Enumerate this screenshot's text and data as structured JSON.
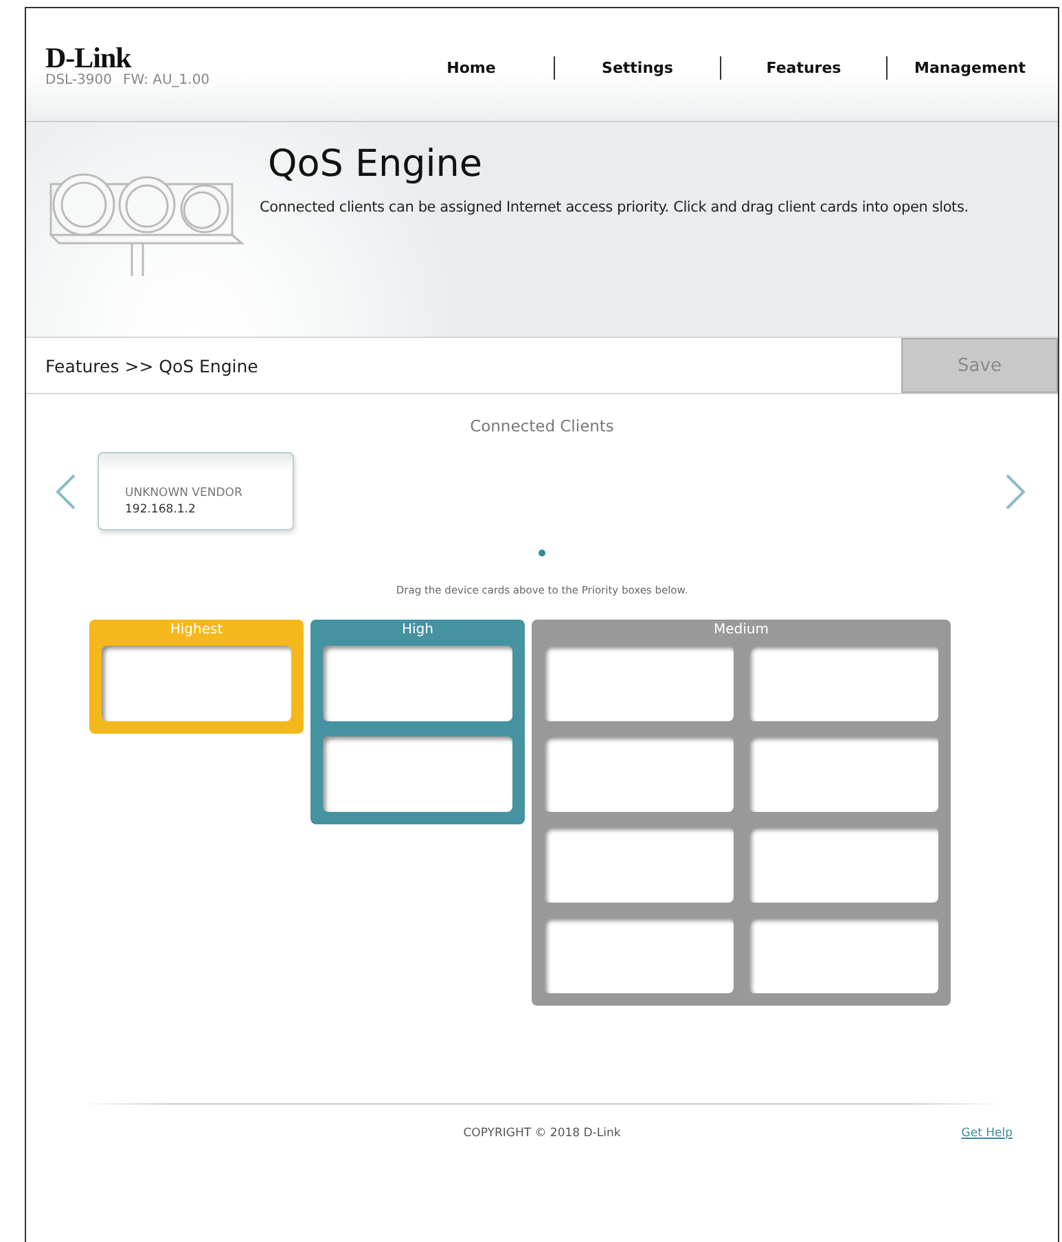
{
  "header": {
    "brand": "D-Link",
    "model": "DSL-3900",
    "firmware": "FW: AU_1.00",
    "nav": [
      {
        "label": "Home"
      },
      {
        "label": "Settings"
      },
      {
        "label": "Features"
      },
      {
        "label": "Management"
      }
    ]
  },
  "banner": {
    "title": "QoS Engine",
    "description": "Connected clients can be assigned Internet access priority. Click and drag client cards into open slots."
  },
  "breadcrumb": "Features >> QoS Engine",
  "save_button": {
    "label": "Save",
    "disabled": true
  },
  "connected_clients": {
    "title": "Connected Clients",
    "clients": [
      {
        "vendor": "UNKNOWN VENDOR",
        "ip": "192.168.1.2"
      }
    ],
    "pages": [
      {
        "selected": true
      }
    ]
  },
  "instruction": "Drag the device cards above to the Priority boxes below.",
  "priority_groups": [
    {
      "name": "Highest",
      "color": "#f5b81c",
      "slots": [
        {
          "empty": true
        }
      ]
    },
    {
      "name": "High",
      "color": "#4592a0",
      "slots": [
        {
          "empty": true
        },
        {
          "empty": true
        }
      ]
    },
    {
      "name": "Medium",
      "color": "#999999",
      "slots": [
        {
          "empty": true
        },
        {
          "empty": true
        },
        {
          "empty": true
        },
        {
          "empty": true
        },
        {
          "empty": true
        },
        {
          "empty": true
        },
        {
          "empty": true
        },
        {
          "empty": true
        }
      ]
    }
  ],
  "footer": {
    "copyright": "COPYRIGHT © 2018 D-Link",
    "help_link": "Get Help"
  }
}
